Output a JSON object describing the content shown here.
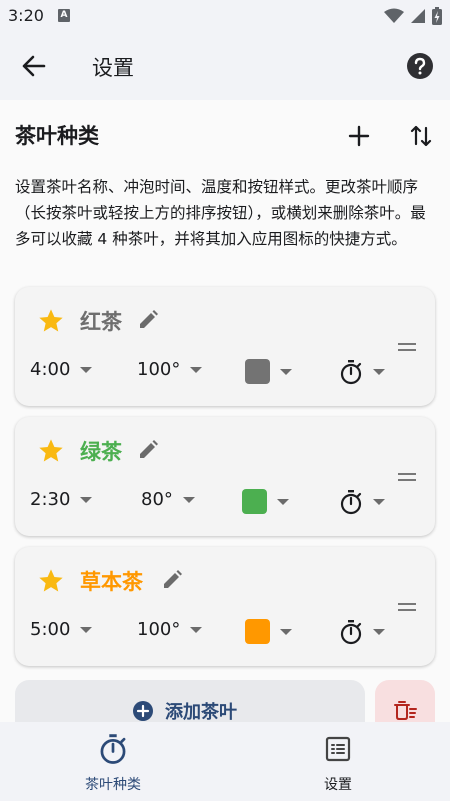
{
  "status_bar": {
    "time": "3:20",
    "notification_letter": "A"
  },
  "app_bar": {
    "title": "设置",
    "back_icon": "arrow-back-icon",
    "help_icon": "help-icon"
  },
  "section": {
    "title": "茶叶种类",
    "add_icon": "plus-icon",
    "sort_icon": "sort-icon"
  },
  "description": "设置茶叶名称、冲泡时间、温度和按钮样式。更改茶叶顺序（长按茶叶或轻按上方的排序按钮），或横划来删除茶叶。最多可以收藏 4 种茶叶，并将其加入应用图标的快捷方式。",
  "teas": [
    {
      "name": "红茶",
      "name_color": "#6e6e6e",
      "time": "4:00",
      "temperature": "100°",
      "color": "#737373",
      "favorite": true
    },
    {
      "name": "绿茶",
      "name_color": "#4caf50",
      "time": "2:30",
      "temperature": "80°",
      "color": "#4caf50",
      "favorite": true
    },
    {
      "name": "草本茶",
      "name_color": "#ff9800",
      "time": "5:00",
      "temperature": "100°",
      "color": "#ff9800",
      "favorite": true
    }
  ],
  "add_tea": {
    "label": "添加茶叶"
  },
  "bottom_nav": [
    {
      "label": "茶叶种类",
      "active": true,
      "icon": "timer-icon"
    },
    {
      "label": "设置",
      "active": false,
      "icon": "settings-list-icon"
    }
  ],
  "colors": {
    "star": "#f9b912",
    "accent": "#2c4a77",
    "delete_bg": "#f8dfe0",
    "delete_icon": "#b3261e"
  }
}
